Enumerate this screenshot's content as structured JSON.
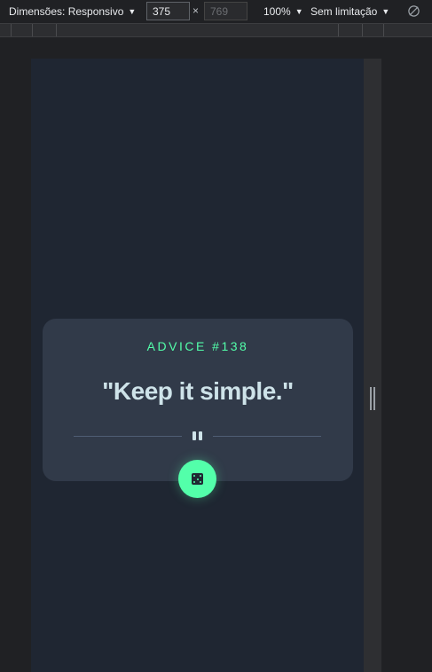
{
  "toolbar": {
    "dimensions_label": "Dimensões: Responsivo",
    "width_value": "375",
    "height_placeholder": "769",
    "times": "×",
    "zoom_label": "100%",
    "throttle_label": "Sem limitação",
    "caret": "▼"
  },
  "card": {
    "advice_id": "ADVICE #138",
    "quote": "\"Keep it simple.\""
  },
  "colors": {
    "accent": "#53ffaa",
    "card_bg": "#313a49",
    "page_bg": "#1f2632",
    "quote_text": "#cee3e9"
  },
  "icons": {
    "divider_icon": "pause-icon",
    "button_icon": "dice-icon",
    "rotate_icon": "rotate-icon"
  }
}
